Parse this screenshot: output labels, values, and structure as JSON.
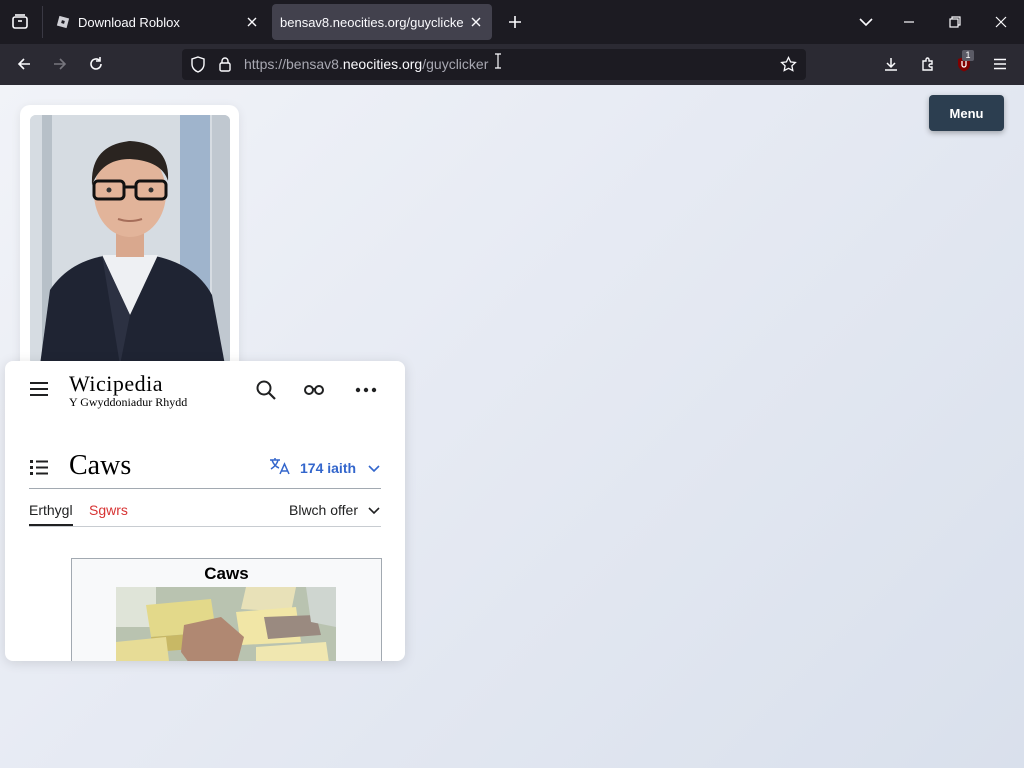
{
  "browser": {
    "tabs": [
      {
        "title": "Download Roblox",
        "active": false
      },
      {
        "title": "bensav8.neocities.org/guyclicker",
        "active": true
      }
    ],
    "url": {
      "prefix": "https://bensav8.",
      "domain": "neocities.org",
      "path": "/guyclicker"
    },
    "extension_badge": "1",
    "icons": {
      "tab_list": "tab-list-icon",
      "back": "back-arrow-icon",
      "forward": "forward-arrow-icon",
      "reload": "reload-icon",
      "shield": "shield-icon",
      "lock": "lock-icon",
      "bookmark": "star-icon",
      "downloads": "download-icon",
      "extensions": "puzzle-icon",
      "ublock": "ublock-icon",
      "app_menu": "hamburger-icon"
    },
    "colors": {
      "tabbar": "#1c1b22",
      "navbar": "#2b2a33",
      "active_tab": "#42414d"
    }
  },
  "page": {
    "menu_button": "Menu",
    "colors": {
      "menu_button": "#2c3e50",
      "background": "#e6eaf3"
    }
  },
  "wiki": {
    "wordmark": "Wicipedia",
    "tagline": "Y Gwyddoniadur Rhydd",
    "title": "Caws",
    "languages": "174 iaith",
    "tab_article": "Erthygl",
    "tab_talk": "Sgwrs",
    "tools": "Blwch offer",
    "infobox_title": "Caws",
    "colors": {
      "link": "#3366cc",
      "redlink": "#d73333"
    }
  }
}
